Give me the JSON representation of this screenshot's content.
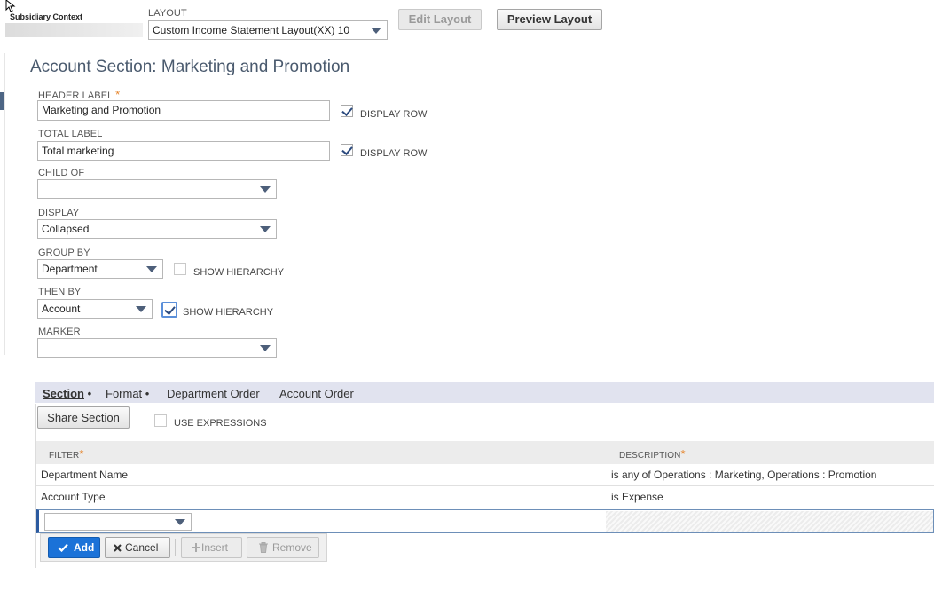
{
  "header": {
    "subsidiary_label": "Subsidiary Context",
    "layout_label": "LAYOUT",
    "layout_value": "Custom Income Statement Layout(XX) 10",
    "edit_layout": "Edit Layout",
    "preview_layout": "Preview Layout"
  },
  "section_title": "Account Section: Marketing and Promotion",
  "form": {
    "header_label": {
      "label": "HEADER LABEL",
      "required": "*",
      "value": "Marketing  and Promotion",
      "display_row": "DISPLAY ROW",
      "display_row_checked": true
    },
    "total_label": {
      "label": "TOTAL LABEL",
      "value": "Total marketing",
      "display_row": "DISPLAY ROW",
      "display_row_checked": true
    },
    "child_of": {
      "label": "CHILD OF",
      "value": ""
    },
    "display": {
      "label": "DISPLAY",
      "value": "Collapsed"
    },
    "group_by": {
      "label": "GROUP BY",
      "value": "Department",
      "show_hierarchy": "SHOW HIERARCHY",
      "show_hierarchy_checked": false
    },
    "then_by": {
      "label": "THEN BY",
      "value": "Account",
      "show_hierarchy": "SHOW HIERARCHY",
      "show_hierarchy_checked": true
    },
    "marker": {
      "label": "MARKER",
      "value": ""
    }
  },
  "tabs": [
    {
      "label": "Section",
      "dot": "•",
      "active": true
    },
    {
      "label": "Format",
      "dot": "•"
    },
    {
      "label": "Department Order"
    },
    {
      "label": "Account Order"
    }
  ],
  "section_tab": {
    "share_section": "Share Section",
    "use_expressions": "USE EXPRESSIONS",
    "columns": {
      "filter": "FILTER",
      "description": "DESCRIPTION",
      "required": "*"
    },
    "rows": [
      {
        "filter": "Department Name",
        "description": "is any of Operations : Marketing, Operations : Promotion"
      },
      {
        "filter": "Account Type",
        "description": "is Expense"
      }
    ],
    "actions": {
      "add": "Add",
      "cancel": "Cancel",
      "insert": "Insert",
      "remove": "Remove"
    }
  },
  "colors": {
    "accent": "#1b72d8",
    "tab_bar": "#e1e3ef",
    "header_row": "#ececec",
    "title": "#4a5a6e"
  }
}
